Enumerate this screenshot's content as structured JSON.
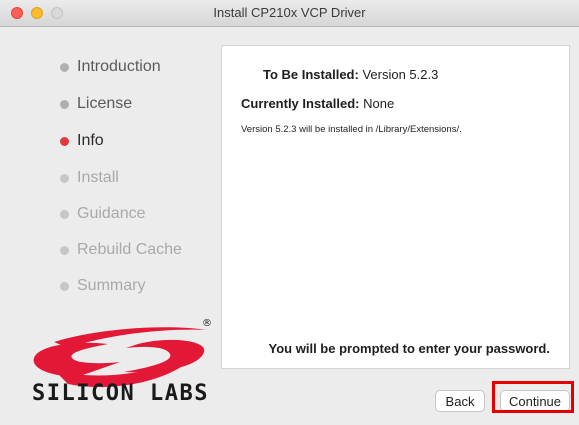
{
  "window": {
    "title": "Install CP210x VCP Driver"
  },
  "steps": [
    {
      "label": "Introduction",
      "state": "done"
    },
    {
      "label": "License",
      "state": "done"
    },
    {
      "label": "Info",
      "state": "current"
    },
    {
      "label": "Install",
      "state": "pending"
    },
    {
      "label": "Guidance",
      "state": "pending"
    },
    {
      "label": "Rebuild Cache",
      "state": "pending"
    },
    {
      "label": "Summary",
      "state": "pending"
    }
  ],
  "info": {
    "to_be_installed_label": "To Be Installed:",
    "to_be_installed_value": "Version 5.2.3",
    "currently_installed_label": "Currently Installed:",
    "currently_installed_value": "None",
    "install_note": "Version 5.2.3 will be installed in /Library/Extensions/.",
    "password_prompt": "You will be prompted to enter your password."
  },
  "brand": {
    "logo_text": "SILICON LABS",
    "accent_color": "#e31837",
    "registered": "®"
  },
  "buttons": {
    "back": "Back",
    "continue": "Continue"
  },
  "colors": {
    "current_step": "#e23a3a",
    "highlight": "#e50000"
  }
}
